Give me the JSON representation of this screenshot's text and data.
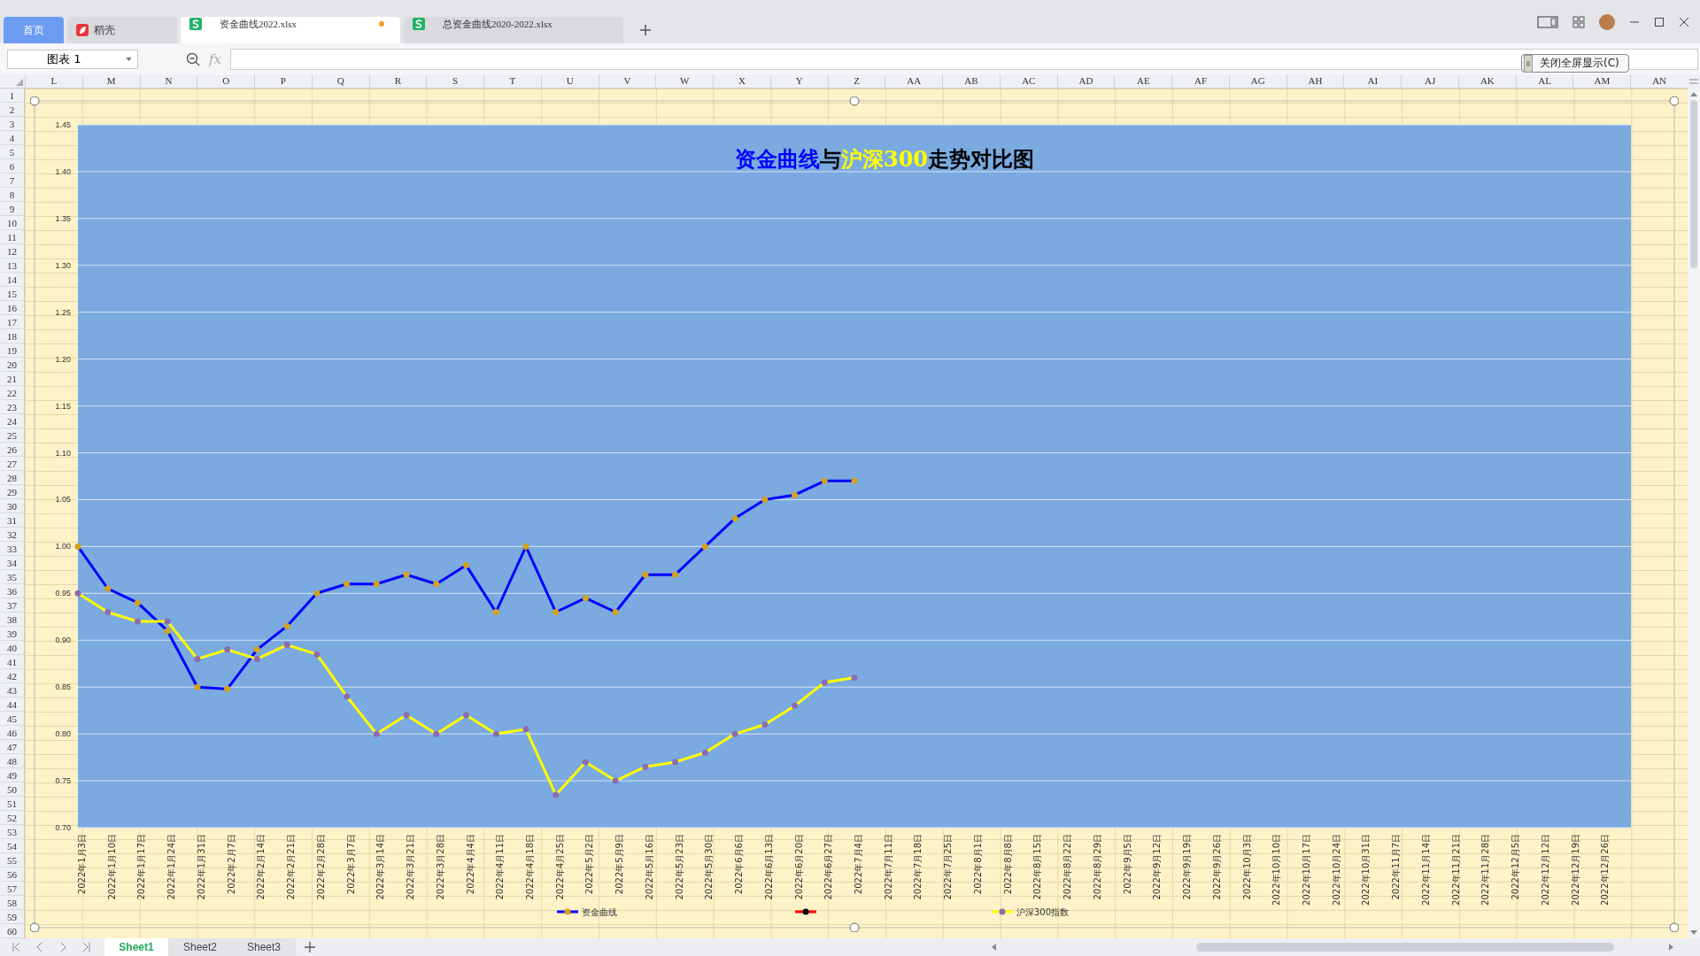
{
  "tabs": [
    {
      "label": "首页",
      "kind": "home",
      "selected": false,
      "unsaved": false
    },
    {
      "label": "稻壳",
      "kind": "docer",
      "selected": false,
      "unsaved": false
    },
    {
      "label": "资金曲线2022.xlsx",
      "kind": "sheet",
      "selected": true,
      "unsaved": true
    },
    {
      "label": "总资金曲线2020-2022.xlsx",
      "kind": "sheet",
      "selected": false,
      "unsaved": false
    }
  ],
  "formula_bar": {
    "name_box": "图表 1",
    "fx_label": "fx"
  },
  "columns": [
    "L",
    "M",
    "N",
    "O",
    "P",
    "Q",
    "R",
    "S",
    "T",
    "U",
    "V",
    "W",
    "X",
    "Y",
    "Z",
    "AA",
    "AB",
    "AC",
    "AD",
    "AE",
    "AF",
    "AG",
    "AH",
    "AI",
    "AJ",
    "AK",
    "AL",
    "AM",
    "AN"
  ],
  "rows": [
    "1",
    "2",
    "3",
    "4",
    "5",
    "6",
    "7",
    "8",
    "9",
    "10",
    "11",
    "12",
    "13",
    "14",
    "15",
    "16",
    "17",
    "18",
    "19",
    "20",
    "21",
    "22",
    "23",
    "24",
    "25",
    "26",
    "27",
    "28",
    "29",
    "30",
    "31",
    "32",
    "33",
    "34",
    "35",
    "36",
    "37",
    "38",
    "39",
    "40",
    "41",
    "42",
    "43",
    "44",
    "45",
    "46",
    "47",
    "48",
    "49",
    "50",
    "51",
    "52",
    "53",
    "54",
    "55",
    "56",
    "57",
    "58",
    "59",
    "60"
  ],
  "fullscreen_button": "关闭全屏显示(C)",
  "chart": {
    "title_parts": [
      {
        "text": "资金曲线",
        "color": "#0000ff"
      },
      {
        "text": "与",
        "color": "#000000"
      },
      {
        "text": "沪深300",
        "color": "#ffff00"
      },
      {
        "text": "走势对比图",
        "color": "#000000"
      }
    ],
    "chart_data": {
      "type": "line",
      "grid": true,
      "legend": true,
      "categories": [
        "2022年1月3日",
        "2022年1月10日",
        "2022年1月17日",
        "2022年1月24日",
        "2022年1月31日",
        "2022年2月7日",
        "2022年2月14日",
        "2022年2月21日",
        "2022年2月28日",
        "2022年3月7日",
        "2022年3月14日",
        "2022年3月21日",
        "2022年3月28日",
        "2022年4月4日",
        "2022年4月11日",
        "2022年4月18日",
        "2022年4月25日",
        "2022年5月2日",
        "2022年5月9日",
        "2022年5月16日",
        "2022年5月23日",
        "2022年5月30日",
        "2022年6月6日",
        "2022年6月13日",
        "2022年6月20日",
        "2022年6月27日",
        "2022年7月4日",
        "2022年7月11日",
        "2022年7月18日",
        "2022年7月25日",
        "2022年8月1日",
        "2022年8月8日",
        "2022年8月15日",
        "2022年8月22日",
        "2022年8月29日",
        "2022年9月5日",
        "2022年9月12日",
        "2022年9月19日",
        "2022年9月26日",
        "2022年10月3日",
        "2022年10月10日",
        "2022年10月17日",
        "2022年10月24日",
        "2022年10月31日",
        "2022年11月7日",
        "2022年11月14日",
        "2022年11月21日",
        "2022年11月28日",
        "2022年12月5日",
        "2022年12月12日",
        "2022年12月19日",
        "2022年12月26日"
      ],
      "series": [
        {
          "name": "资金曲线",
          "color": "#0000ff",
          "marker": {
            "shape": "circle",
            "color": "#d4a21c"
          },
          "values": [
            1.0,
            0.955,
            0.94,
            0.91,
            0.85,
            0.848,
            0.89,
            0.915,
            0.95,
            0.96,
            0.96,
            0.97,
            0.96,
            0.98,
            0.93,
            1.0,
            0.93,
            0.945,
            0.93,
            0.97,
            0.97,
            1.0,
            1.03,
            1.05,
            1.055,
            1.07,
            1.07,
            null,
            null,
            null,
            null,
            null,
            null,
            null,
            null,
            null,
            null,
            null,
            null,
            null,
            null,
            null,
            null,
            null,
            null,
            null,
            null,
            null,
            null,
            null,
            null,
            null
          ]
        },
        {
          "color": "#ff0000",
          "marker": {
            "shape": "circle",
            "color": "#000000"
          },
          "values": [
            null,
            null,
            null,
            null,
            null,
            null,
            null,
            null,
            null,
            null,
            null,
            null,
            null,
            null,
            null,
            null,
            null,
            null,
            null,
            null,
            null,
            null,
            null,
            null,
            null,
            null,
            null,
            null,
            null,
            null,
            null,
            null,
            null,
            null,
            null,
            null,
            null,
            null,
            null,
            null,
            null,
            null,
            null,
            null,
            null,
            null,
            null,
            null,
            null,
            null,
            null,
            null
          ]
        },
        {
          "name": "沪深300指数",
          "color": "#ffff00",
          "marker": {
            "shape": "circle",
            "color": "#8c6cb0"
          },
          "values": [
            0.95,
            0.93,
            0.92,
            0.92,
            0.88,
            0.89,
            0.88,
            0.895,
            0.885,
            0.84,
            0.8,
            0.82,
            0.8,
            0.82,
            0.8,
            0.805,
            0.735,
            0.77,
            0.75,
            0.765,
            0.77,
            0.78,
            0.8,
            0.81,
            0.83,
            0.855,
            0.86,
            null,
            null,
            null,
            null,
            null,
            null,
            null,
            null,
            null,
            null,
            null,
            null,
            null,
            null,
            null,
            null,
            null,
            null,
            null,
            null,
            null,
            null,
            null,
            null,
            null
          ]
        }
      ],
      "ylim": [
        0.7,
        1.45
      ],
      "yticks": [
        {
          "value": 0.7,
          "label": "0.70"
        },
        {
          "value": 0.75,
          "label": "0.75"
        },
        {
          "value": 0.8,
          "label": "0.80"
        },
        {
          "value": 0.85,
          "label": "0.85"
        },
        {
          "value": 0.9,
          "label": "0.90"
        },
        {
          "value": 0.95,
          "label": "0.95"
        },
        {
          "value": 1.0,
          "label": "1.00"
        },
        {
          "value": 1.05,
          "label": "1.05"
        },
        {
          "value": 1.1,
          "label": "1.10"
        },
        {
          "value": 1.15,
          "label": "1.15"
        },
        {
          "value": 1.2,
          "label": "1.20"
        },
        {
          "value": 1.25,
          "label": "1.25"
        },
        {
          "value": 1.3,
          "label": "1.30"
        },
        {
          "value": 1.35,
          "label": "1.35"
        },
        {
          "value": 1.4,
          "label": "1.40"
        },
        {
          "value": 1.45,
          "label": "1.45"
        }
      ]
    }
  },
  "sheet_tabs": [
    {
      "label": "Sheet1",
      "selected": true
    },
    {
      "label": "Sheet2",
      "selected": false
    },
    {
      "label": "Sheet3",
      "selected": false
    }
  ]
}
